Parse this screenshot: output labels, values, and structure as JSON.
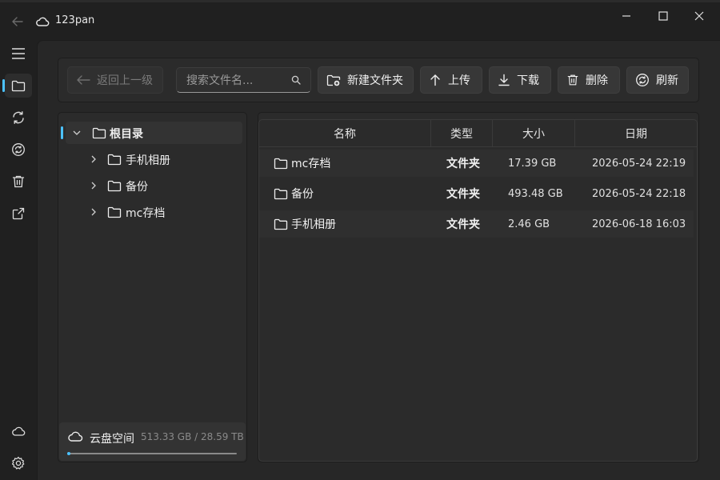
{
  "window": {
    "title": "123pan"
  },
  "toolbar": {
    "back_label": "返回上一级",
    "search_placeholder": "搜索文件名...",
    "new_folder_label": "新建文件夹",
    "upload_label": "上传",
    "download_label": "下载",
    "delete_label": "删除",
    "refresh_label": "刷新"
  },
  "tree": {
    "root": "根目录",
    "children": [
      "手机相册",
      "备份",
      "mc存档"
    ]
  },
  "storage": {
    "label": "云盘空间",
    "value": "513.33 GB / 28.59 TB",
    "used_fraction": 0.0175
  },
  "table": {
    "columns": [
      "名称",
      "类型",
      "大小",
      "日期"
    ],
    "rows": [
      {
        "name": "mc存档",
        "type": "文件夹",
        "size": "17.39 GB",
        "date": "2026-05-24 22:19"
      },
      {
        "name": "备份",
        "type": "文件夹",
        "size": "493.48 GB",
        "date": "2026-05-24 22:18"
      },
      {
        "name": "手机相册",
        "type": "文件夹",
        "size": "2.46 GB",
        "date": "2026-06-18 16:03"
      }
    ]
  },
  "icons": {
    "rail": [
      "menu-icon",
      "folder-icon",
      "sync-icon",
      "refresh-icon",
      "trash-icon",
      "share-icon",
      "cloud-icon",
      "gear-icon"
    ]
  },
  "colors": {
    "accent": "#4cc2ff",
    "background": "#202020",
    "panel": "#2b2b2b"
  }
}
